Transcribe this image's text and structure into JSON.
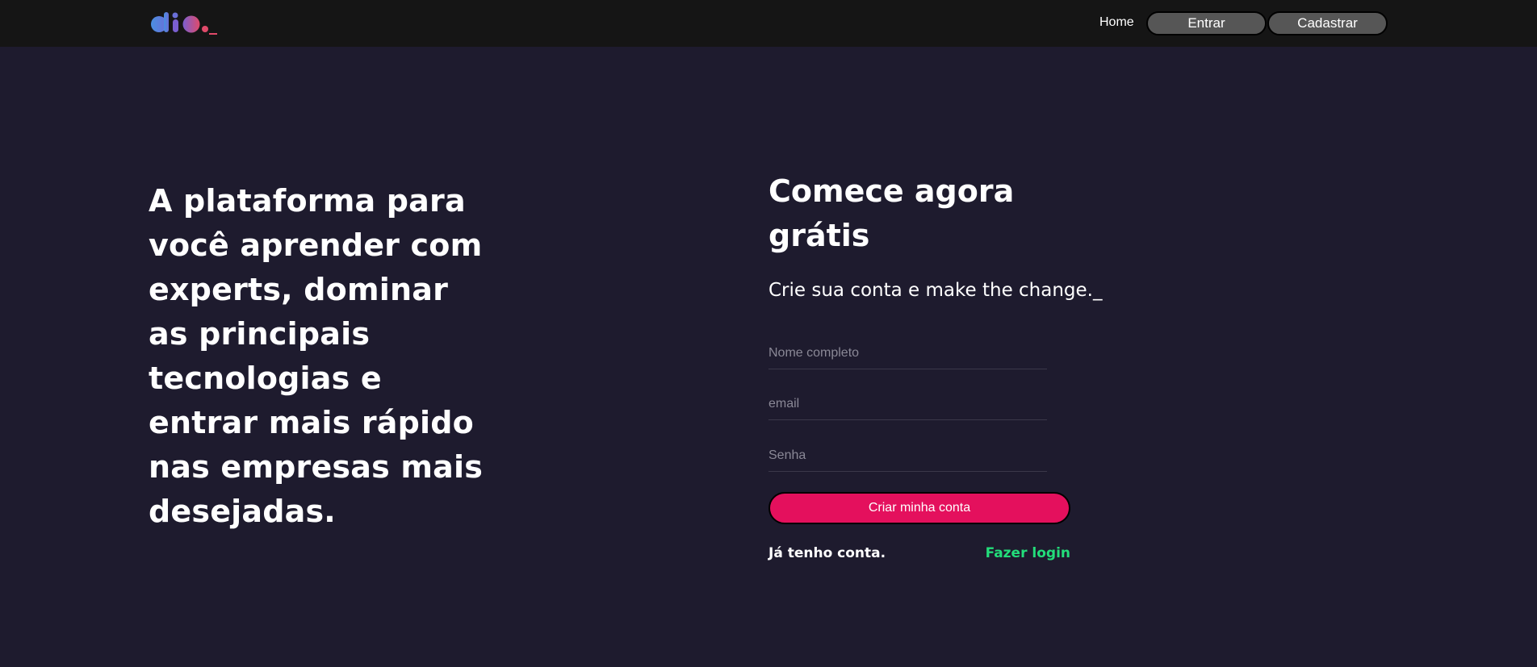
{
  "header": {
    "logo_icon": "dio-logo-icon",
    "nav": {
      "home_label": "Home",
      "login_button_label": "Entrar",
      "signup_button_label": "Cadastrar"
    }
  },
  "hero": {
    "headline": "A plataforma para você aprender com experts, dominar as principais tecnologias e entrar mais rápido nas empresas mais desejadas."
  },
  "signup_form": {
    "title": "Comece agora grátis",
    "subtitle": "Crie sua conta e make the change._",
    "name_placeholder": "Nome completo",
    "email_placeholder": "email",
    "password_placeholder": "Senha",
    "submit_label": "Criar minha conta",
    "have_account_text": "Já tenho conta.",
    "login_link_label": "Fazer login"
  },
  "colors": {
    "background": "#1e1b2e",
    "topbar": "#151515",
    "nav_button": "#565656",
    "accent_pink": "#e4105d",
    "accent_green": "#23dd7a",
    "logo_blue": "#4a8fe0",
    "logo_pink": "#e04a6a"
  }
}
